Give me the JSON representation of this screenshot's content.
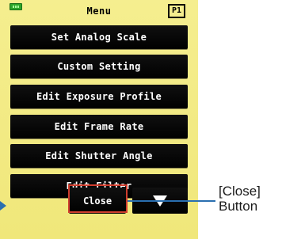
{
  "header": {
    "title": "Menu",
    "page_indicator": "P1"
  },
  "menu": {
    "items": [
      "Set Analog Scale",
      "Custom Setting",
      "Edit Exposure Profile",
      "Edit Frame Rate",
      "Edit Shutter Angle",
      "Edit Filter"
    ]
  },
  "footer": {
    "close_label": "Close",
    "next_icon": "down-triangle-icon"
  },
  "annotation": {
    "line1": "[Close]",
    "line2": "Button",
    "color": "#2a6fb0",
    "highlight_color": "#d03e2e"
  },
  "colors": {
    "screen_bg": "#f3ea84",
    "button_bg": "#000000",
    "battery": "#2ea52a"
  }
}
